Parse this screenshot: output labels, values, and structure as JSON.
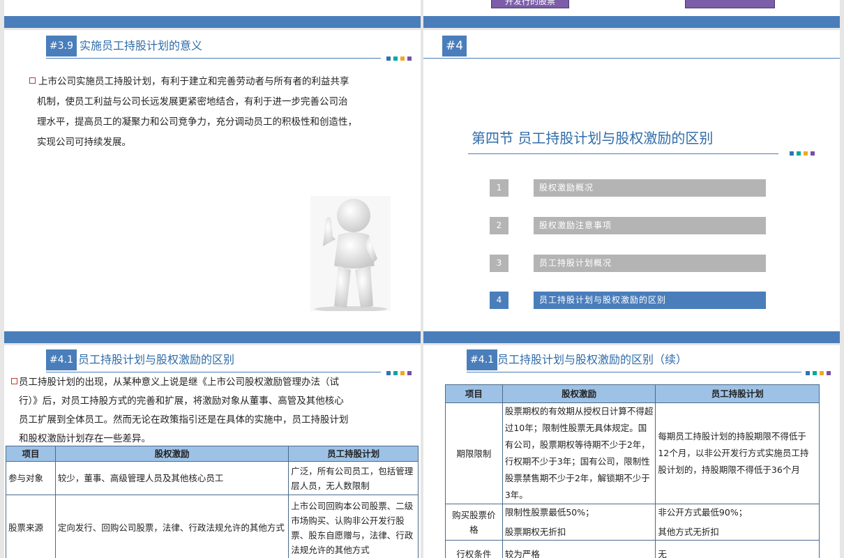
{
  "slide_top_left": {},
  "slide_top_right": {
    "fragment_button": "开发行的股票"
  },
  "slide1": {
    "badge": "#3.9",
    "title": "实施员工持股计划的意义",
    "paragraph": "上市公司实施员工持股计划，有利于建立和完善劳动者与所有者的利益共享机制，使员工利益与公司长远发展更紧密地结合，有利于进一步完善公司治理水平，提高员工的凝聚力和公司竞争力，充分调动员工的积极性和创造性，实现公司可持续发展。",
    "lines": [
      "上市公司实施员工持股计划，有利于建立和完善劳动者与所有者的利益共享",
      "机制，使员工利益与公司长远发展更紧密地结合，有利于进一步完善公司治",
      "理水平，提高员工的凝聚力和公司竞争力，充分调动员工的积极性和创造性，",
      "实现公司可持续发展。"
    ]
  },
  "slide2": {
    "badge": "#4",
    "title": "第四节  员工持股计划与股权激励的区别",
    "menu": [
      {
        "num": "1",
        "label": "股权激励概况"
      },
      {
        "num": "2",
        "label": "股权激励注意事项"
      },
      {
        "num": "3",
        "label": "员工持股计划概况"
      },
      {
        "num": "4",
        "label": "员工持股计划与股权激励的区别"
      }
    ]
  },
  "slide3": {
    "badge": "#4.1",
    "title": "员工持股计划与股权激励的区别",
    "lines": [
      "员工持股计划的出现，从某种意义上说是继《上市公司股权激励管理办法（试",
      "行）》后，对员工持股方式的完善和扩展，将激励对象从董事、高管及其他核心",
      "员工扩展到全体员工。然而无论在政策指引还是在具体的实施中，员工持股计划",
      "和股权激励计划存在一些差异。"
    ],
    "table": {
      "headers": [
        "项目",
        "股权激励",
        "员工持股计划"
      ],
      "rows": [
        [
          "参与对象",
          "较少，董事、高级管理人员及其他核心员工",
          "广泛，所有公司员工，包括管理层人员，无人数限制"
        ],
        [
          "股票来源",
          "定向发行、回购公司股票，法律、行政法规允许的其他方式",
          "上市公司回购本公司股票、二级市场购买、认购非公开发行股票、股东自愿赠与，法律、行政法规允许的其他方式"
        ]
      ]
    }
  },
  "slide4": {
    "badge": "#4.1",
    "title": "员工持股计划与股权激励的区别（续）",
    "table": {
      "headers": [
        "项目",
        "股权激励",
        "员工持股计划"
      ],
      "rows": [
        [
          "期限限制",
          "股票期权的有效期从授权日计算不得超过10年；限制性股票无具体规定。国有公司，股票期权等待期不少于2年，行权期不少于3年；国有公司，限制性股票禁售期不少于2年，解锁期不少于3年。",
          "每期员工持股计划的持股期限不得低于12个月，以非公开发行方式实施员工持股计划的，持股期限不得低于36个月"
        ],
        [
          "购买股票价格",
          "限制性股票最低50%；\n\n股票期权无折扣",
          "非公开方式最低90%；\n\n其他方式无折扣"
        ],
        [
          "行权条件",
          "较为严格",
          "无"
        ]
      ]
    }
  },
  "colors": {
    "accent": "#4a7ebb",
    "title": "#2f6ca8",
    "menu_gray": "#b4b4b4",
    "menu_active": "#4a7ebb",
    "header_fill": "#9ec2e6",
    "sq1": "#2e74b5",
    "sq2": "#00a99d",
    "sq3": "#f5a623",
    "sq4": "#7b4fa0"
  }
}
